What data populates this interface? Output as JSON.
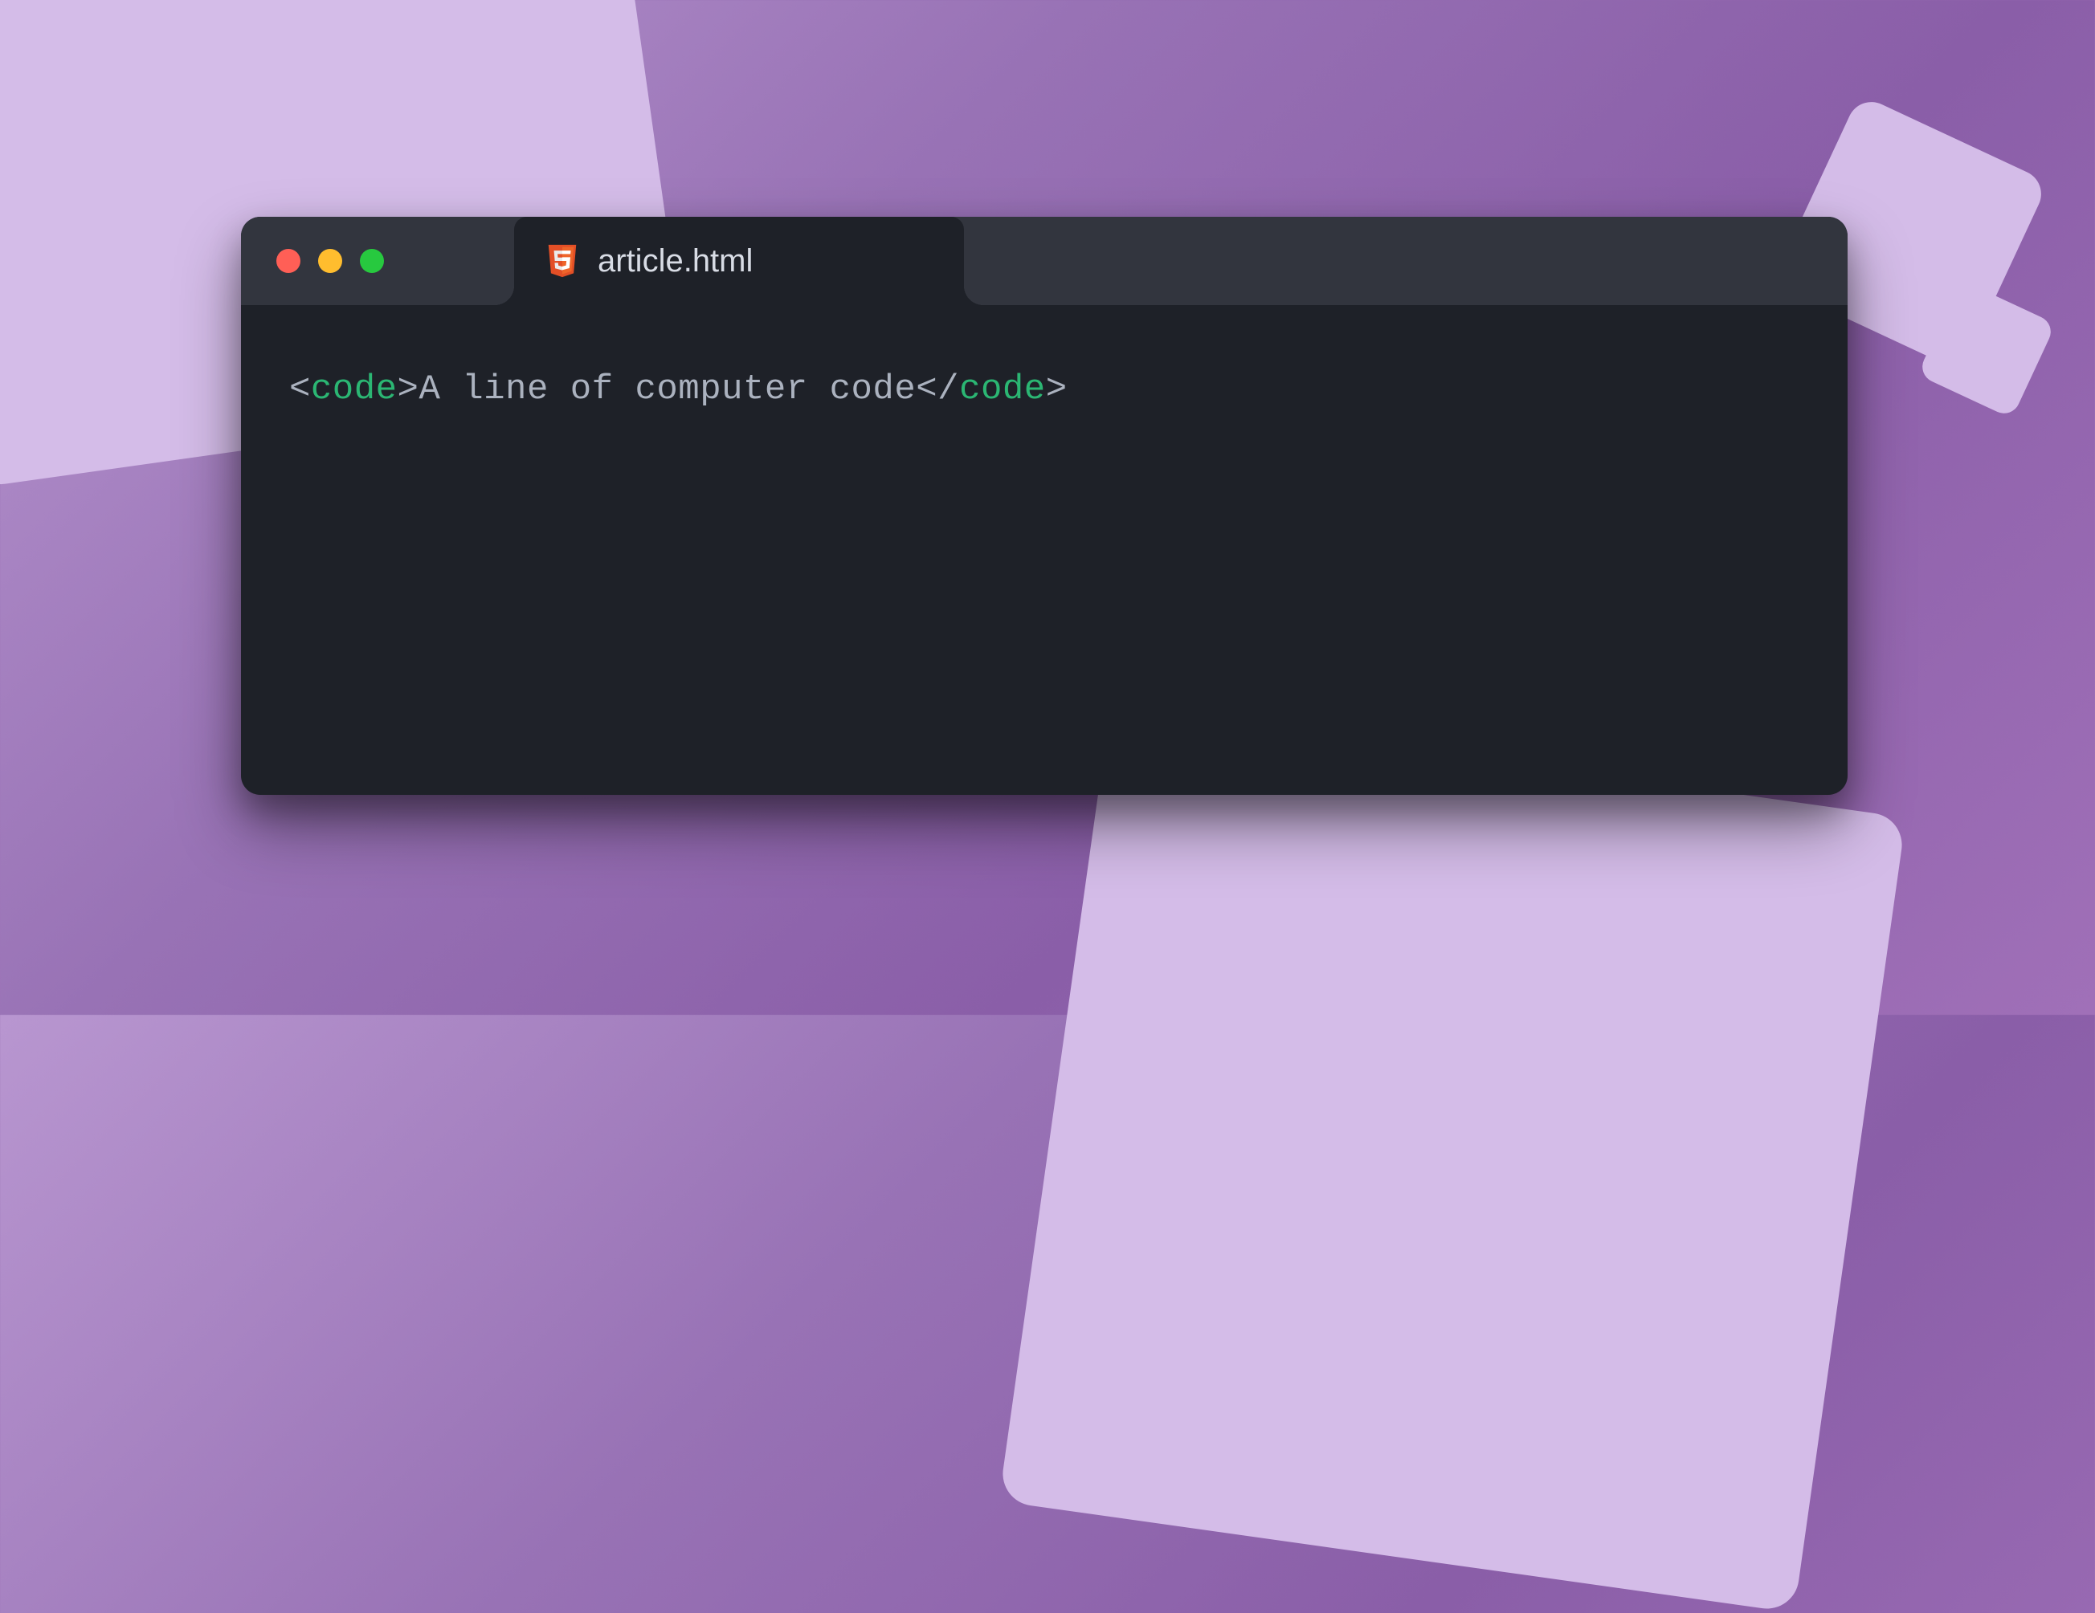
{
  "tab": {
    "filename": "article.html",
    "icon": "html5-icon"
  },
  "traffic_lights": {
    "red": "#ff5f56",
    "yellow": "#ffbd2e",
    "green": "#27c93f"
  },
  "code": {
    "open_bracket": "<",
    "close_bracket": ">",
    "slash": "/",
    "tag_name": "code",
    "content": "A line of computer code"
  },
  "colors": {
    "editor_bg": "#1e2128",
    "titlebar_bg": "#32353e",
    "tag_color": "#2bb673",
    "text_color": "#abb2bf",
    "bg_shape": "#d4bce8"
  }
}
